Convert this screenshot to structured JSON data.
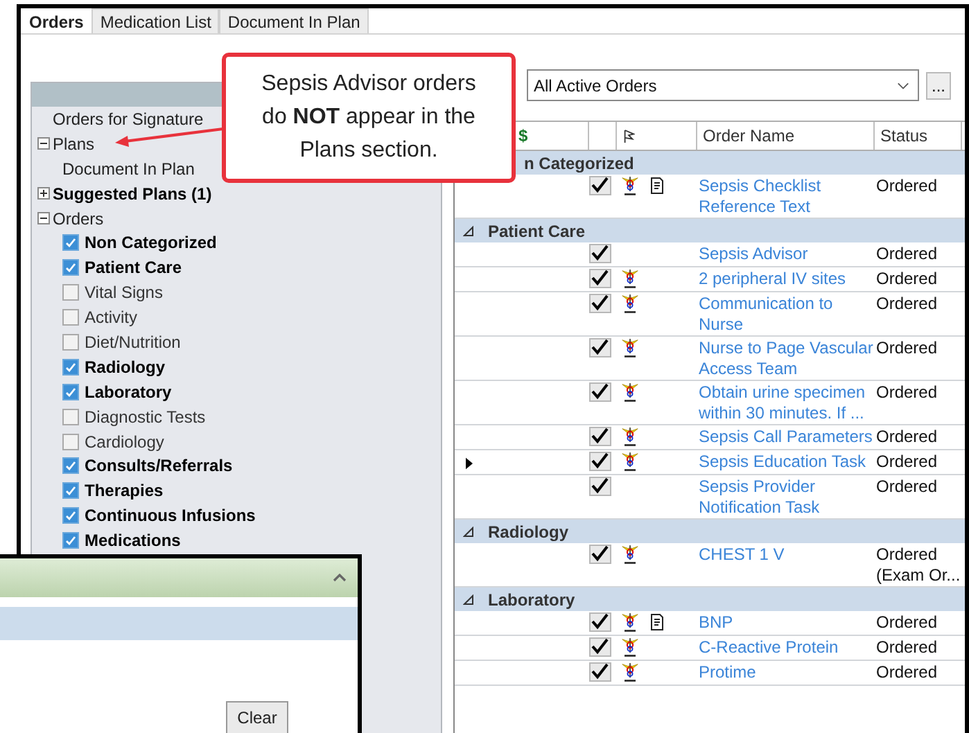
{
  "tabs": [
    {
      "label": "Orders",
      "selected": true
    },
    {
      "label": "Medication List",
      "selected": false
    },
    {
      "label": "Document In Plan",
      "selected": false
    }
  ],
  "sidebar": {
    "items": [
      {
        "label": "Orders for Signature",
        "bold": false
      },
      {
        "label": "Plans",
        "bold": false,
        "expanded": true,
        "children": [
          {
            "label": "Document In Plan"
          }
        ]
      },
      {
        "label": "Suggested Plans (1)",
        "bold": true,
        "expanded": false
      },
      {
        "label": "Orders",
        "bold": false,
        "expanded": true,
        "children": [
          {
            "label": "Non Categorized",
            "checked": true
          },
          {
            "label": "Patient Care",
            "checked": true
          },
          {
            "label": "Vital Signs",
            "checked": false
          },
          {
            "label": "Activity",
            "checked": false
          },
          {
            "label": "Diet/Nutrition",
            "checked": false
          },
          {
            "label": "Radiology",
            "checked": true
          },
          {
            "label": "Laboratory",
            "checked": true
          },
          {
            "label": "Diagnostic Tests",
            "checked": false
          },
          {
            "label": "Cardiology",
            "checked": false
          },
          {
            "label": "Consults/Referrals",
            "checked": true
          },
          {
            "label": "Therapies",
            "checked": true
          },
          {
            "label": "Continuous Infusions",
            "checked": true
          },
          {
            "label": "Medications",
            "checked": true
          }
        ]
      }
    ]
  },
  "filter": {
    "value": "All Active Orders"
  },
  "more_button": "...",
  "table": {
    "columns": [
      "$",
      "Order Name",
      "Status"
    ],
    "groups": [
      {
        "label": "n Categorized",
        "rows": [
          {
            "name": "Sepsis Checklist Reference Text",
            "status": "Ordered",
            "checked": true,
            "caduceus": true,
            "document": true,
            "current": false
          }
        ]
      },
      {
        "label": "Patient Care",
        "expanded": true,
        "rows": [
          {
            "name": "Sepsis Advisor",
            "status": "Ordered",
            "checked": true,
            "caduceus": false,
            "document": false,
            "current": false
          },
          {
            "name": "2 peripheral IV sites",
            "status": "Ordered",
            "checked": true,
            "caduceus": true,
            "document": false,
            "current": false
          },
          {
            "name": "Communication to Nurse",
            "status": "Ordered",
            "checked": true,
            "caduceus": true,
            "document": false,
            "current": false
          },
          {
            "name": "Nurse to Page Vascular Access Team",
            "status": "Ordered",
            "checked": true,
            "caduceus": true,
            "document": false,
            "current": false
          },
          {
            "name": "Obtain urine specimen within 30 minutes.  If ...",
            "status": "Ordered",
            "checked": true,
            "caduceus": true,
            "document": false,
            "current": false
          },
          {
            "name": "Sepsis Call Parameters",
            "status": "Ordered",
            "checked": true,
            "caduceus": true,
            "document": false,
            "current": false
          },
          {
            "name": "Sepsis Education Task",
            "status": "Ordered",
            "checked": true,
            "caduceus": true,
            "document": false,
            "current": true
          },
          {
            "name": "Sepsis Provider Notification Task",
            "status": "Ordered",
            "checked": true,
            "caduceus": false,
            "document": false,
            "current": false
          }
        ]
      },
      {
        "label": "Radiology",
        "expanded": true,
        "rows": [
          {
            "name": "CHEST 1 V",
            "status": "Ordered (Exam Or...",
            "checked": true,
            "caduceus": true,
            "document": false,
            "current": false
          }
        ]
      },
      {
        "label": "Laboratory",
        "expanded": true,
        "rows": [
          {
            "name": "BNP",
            "status": "Ordered",
            "checked": true,
            "caduceus": true,
            "document": true,
            "current": false
          },
          {
            "name": "C-Reactive Protein",
            "status": "Ordered",
            "checked": true,
            "caduceus": true,
            "document": false,
            "current": false
          },
          {
            "name": "Protime",
            "status": "Ordered",
            "checked": true,
            "caduceus": true,
            "document": false,
            "current": false
          }
        ]
      }
    ]
  },
  "callout": {
    "text": "Sepsis Advisor orders do **NOT** appear in the Plans section."
  },
  "popup": {
    "button": "Clear"
  }
}
